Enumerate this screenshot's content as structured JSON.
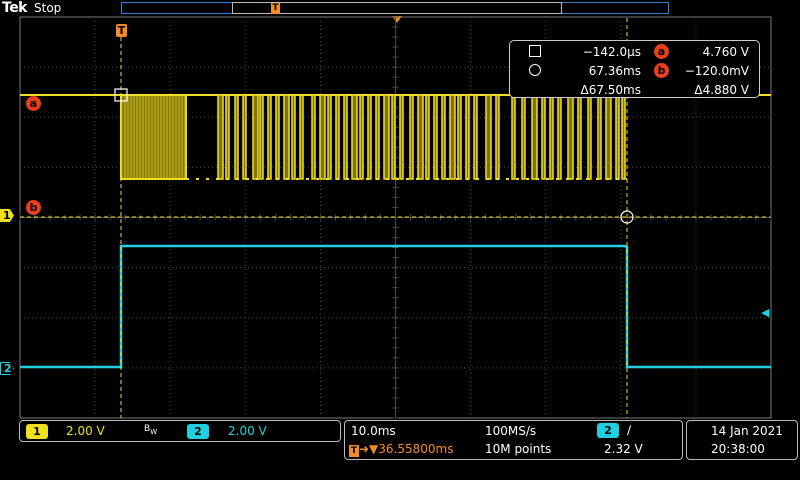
{
  "header": {
    "brand": "Tek",
    "acq_state": "Stop",
    "record_trigger_marker": "T"
  },
  "markers": {
    "trigger": "T",
    "cursor_a": "a",
    "cursor_b": "b",
    "ch1": "1",
    "ch2": "2"
  },
  "cursor_readout": {
    "a_time": "−142.0μs",
    "a_label": "a",
    "a_value": "4.760 V",
    "b_time": "67.36ms",
    "b_label": "b",
    "b_value": "−120.0mV",
    "delta_time": "Δ67.50ms",
    "delta_value": "Δ4.880 V"
  },
  "channels": {
    "ch1_label": "1",
    "ch1_scale": "2.00 V",
    "bw_label": "B",
    "bw_sub": "W",
    "ch2_label": "2",
    "ch2_scale": "2.00 V",
    "ch1_color": "#f0e020",
    "ch2_color": "#20d0e0"
  },
  "horizontal": {
    "time_div": "10.0ms",
    "sample_rate": "100MS/s",
    "trigger_source": "2",
    "trigger_slope": "∕",
    "trigger_offset": "36.55800ms",
    "record_length": "10M points",
    "trigger_level": "2.32 V"
  },
  "datetime": {
    "date": "14 Jan  2021",
    "time": "20:38:00"
  },
  "colors": {
    "trigger": "#f28c28",
    "cursor": "#e8401c",
    "grid": "#4a4a4a"
  }
}
